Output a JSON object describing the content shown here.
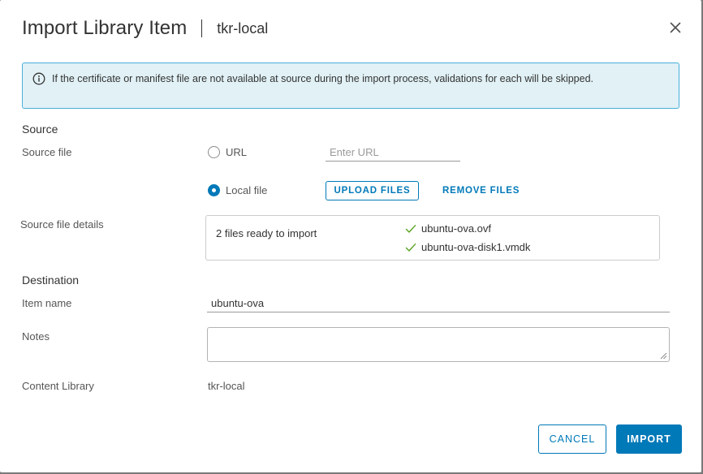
{
  "dialog": {
    "title": "Import Library Item",
    "subtitle": "tkr-local",
    "close_icon": "close-icon"
  },
  "alert": {
    "icon": "info-icon",
    "text": "If the certificate or manifest file are not available at source during the import process, validations for each will be skipped.",
    "colors": {
      "background": "#e1f1f6",
      "border": "#49afd9"
    }
  },
  "source": {
    "section_label": "Source",
    "source_file_label": "Source file",
    "url_option_label": "URL",
    "url_option_selected": false,
    "url_placeholder": "Enter URL",
    "url_value": "",
    "local_option_label": "Local file",
    "local_option_selected": true,
    "upload_button": "UPLOAD FILES",
    "remove_button": "REMOVE FILES",
    "details_label": "Source file details",
    "details_status": "2 files ready to import",
    "files": [
      {
        "name": "ubuntu-ova.ovf",
        "icon": "check-icon"
      },
      {
        "name": "ubuntu-ova-disk1.vmdk",
        "icon": "check-icon"
      }
    ]
  },
  "destination": {
    "section_label": "Destination",
    "item_name_label": "Item name",
    "item_name_value": "ubuntu-ova",
    "notes_label": "Notes",
    "notes_value": "",
    "content_library_label": "Content Library",
    "content_library_value": "tkr-local"
  },
  "footer": {
    "cancel_button": "CANCEL",
    "import_button": "IMPORT"
  },
  "colors": {
    "accent": "#0079b8",
    "success": "#5aa220"
  }
}
